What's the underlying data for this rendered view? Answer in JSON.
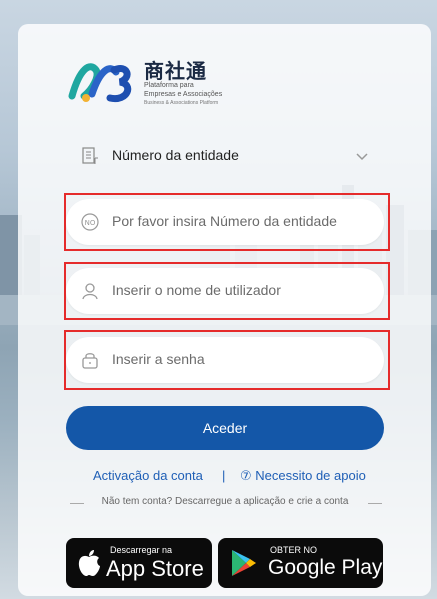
{
  "brand": {
    "name": "商社通",
    "sub1": "Plataforma para",
    "sub2": "Empresas e Associações",
    "sub3": "Business & Associations Platform"
  },
  "entity_select": {
    "value": "Número da entidade"
  },
  "entity_input": {
    "placeholder": "Por favor insira Número da entidade",
    "icon_text": "NO"
  },
  "username_input": {
    "placeholder": "Inserir o nome de utilizador"
  },
  "password_input": {
    "placeholder": "Inserir a senha"
  },
  "login_button": {
    "label": "Aceder"
  },
  "links": {
    "activate": "Activação da conta",
    "separator": "|",
    "help": "⑦ Necessito de apoio"
  },
  "hint": "Não tem conta? Descarregue a aplicação e crie a conta",
  "stores": {
    "apple_small": "Descarregar na",
    "apple_big": "App Store",
    "google_small": "OBTER NO",
    "google_big": "Google Play"
  },
  "colors": {
    "primary": "#1457a8",
    "link": "#1f5fb6",
    "highlight": "#e52b2b"
  }
}
